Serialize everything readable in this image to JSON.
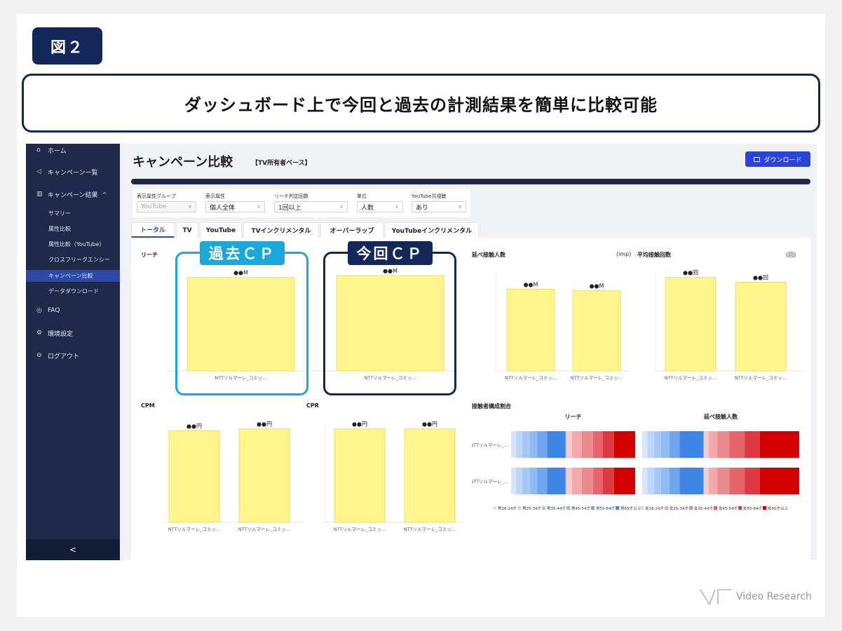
{
  "figure_label": "図２",
  "headline": "ダッシュボード上で今回と過去の計測結果を簡単に比較可能",
  "sidebar": {
    "items": [
      {
        "icon": "home-icon",
        "glyph": "⌂",
        "label": "ホーム"
      },
      {
        "icon": "megaphone-icon",
        "glyph": "◁",
        "label": "キャンペーン一覧"
      },
      {
        "icon": "chart-icon",
        "glyph": "▥",
        "label": "キャンペーン結果",
        "caret": "^"
      },
      {
        "icon": "faq-icon",
        "glyph": "◎",
        "label": "FAQ"
      },
      {
        "icon": "gear-icon",
        "glyph": "⚙",
        "label": "環境設定"
      },
      {
        "icon": "logout-icon",
        "glyph": "⊖",
        "label": "ログアウト"
      }
    ],
    "subitems": [
      "サマリー",
      "属性比較",
      "属性比較（YouTube）",
      "クロスフリークエンシー",
      "キャンペーン比較",
      "データダウンロード"
    ],
    "active_subitem": 4,
    "collapse_glyph": "<"
  },
  "page": {
    "title": "キャンペーン比較",
    "subtitle": "【TV所有者ベース】",
    "download_label": "ダウンロード"
  },
  "filters": [
    {
      "label": "表示属性グループ",
      "value": "YouTube",
      "disabled": true
    },
    {
      "label": "表示属性",
      "value": "個人全体"
    },
    {
      "label": "リーチ判定回数",
      "value": "1回以上"
    },
    {
      "label": "単位",
      "value": "人数"
    },
    {
      "label": "YouTube共視聴",
      "value": "あり"
    }
  ],
  "tabs": [
    "トータル",
    "TV",
    "YouTube",
    "TVインクリメンタル",
    "オーバーラップ",
    "YouTubeインクリメンタル"
  ],
  "active_tab": 0,
  "callouts": {
    "past": {
      "label": "過去ＣＰ",
      "color": "#1aa7dc"
    },
    "current": {
      "label": "今回ＣＰ",
      "color": "#13275a"
    }
  },
  "colors": {
    "bar": "#fff58c",
    "bar_border": "#e8df6a",
    "accent": "#2a45d6",
    "sidebar": "#1f2a4a"
  },
  "chart_data": [
    {
      "type": "bar",
      "title": "リーチ",
      "unit": "",
      "categories": [
        "NTTソルマーレ_コミッ...",
        "NTTソルマーレ_コミッ..."
      ],
      "values": [
        100,
        102
      ],
      "labels": [
        "●●M",
        "●●M"
      ],
      "ylim": [
        0,
        105
      ]
    },
    {
      "type": "bar",
      "title": "延べ接触人数",
      "unit": "(imp)",
      "categories": [
        "NTTソルマーレ_コミッ...",
        "NTTソルマーレ_コミッ..."
      ],
      "values": [
        100,
        98
      ],
      "labels": [
        "●●M",
        "●●M"
      ],
      "ylim": [
        0,
        120
      ]
    },
    {
      "type": "bar",
      "title": "平均接触回数",
      "unit": "(回)",
      "categories": [
        "NTTソルマーレ_コミッ...",
        "NTTソルマーレ_コミッ..."
      ],
      "values": [
        100,
        95
      ],
      "labels": [
        "●●回",
        "●●回"
      ],
      "ylim": [
        0,
        105
      ]
    },
    {
      "type": "bar",
      "title": "CPM",
      "unit": "",
      "categories": [
        "NTTソルマーレ_コミッ...",
        "NTTソルマーレ_コミッ..."
      ],
      "values": [
        98,
        100
      ],
      "labels": [
        "●●円",
        "●●円"
      ],
      "ylim": [
        0,
        105
      ]
    },
    {
      "type": "bar",
      "title": "CPR",
      "unit": "",
      "categories": [
        "NTTソルマーレ_コミッ...",
        "NTTソルマーレ_コミッ..."
      ],
      "values": [
        100,
        100
      ],
      "labels": [
        "●●円",
        "●●円"
      ],
      "ylim": [
        0,
        105
      ]
    },
    {
      "type": "bar",
      "stacked": "100%",
      "title": "接触者構成割合",
      "panels": [
        "リーチ",
        "延べ接触人数"
      ],
      "rows": [
        "NTTソルマーレ_...",
        "NTTソルマーレ_..."
      ],
      "legend": [
        "男18-24才",
        "男25-34才",
        "男35-44才",
        "男45-54才",
        "男55-64才",
        "男65才以上",
        "女18-24才",
        "女25-34才",
        "女35-44才",
        "女45-54才",
        "女55-64才",
        "女65才以上"
      ],
      "segment_colors": [
        "#d8e6fb",
        "#bcd6fa",
        "#a6c8f6",
        "#8fbaf3",
        "#6fa5ee",
        "#3d86e6",
        "#f6c9cc",
        "#f1a9ad",
        "#ea8a8f",
        "#e4666c",
        "#dc3a40",
        "#d40000"
      ],
      "series": [
        {
          "panel": "リーチ",
          "row": 0,
          "values": [
            4,
            5,
            6,
            6,
            8,
            15,
            5,
            8,
            9,
            8,
            9,
            17
          ]
        },
        {
          "panel": "リーチ",
          "row": 1,
          "values": [
            4,
            5,
            6,
            6,
            8,
            15,
            5,
            8,
            9,
            8,
            9,
            17
          ]
        },
        {
          "panel": "延べ接触人数",
          "row": 0,
          "values": [
            3,
            4,
            4,
            5,
            6,
            14,
            3,
            5,
            7,
            9,
            9,
            23
          ]
        },
        {
          "panel": "延べ接触人数",
          "row": 1,
          "values": [
            3,
            4,
            4,
            5,
            6,
            14,
            3,
            5,
            7,
            9,
            9,
            23
          ]
        }
      ]
    }
  ],
  "logo_text": "Video Research"
}
